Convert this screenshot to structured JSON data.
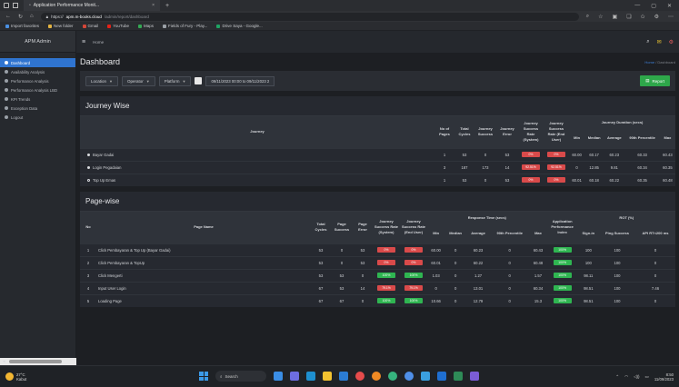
{
  "browser": {
    "tab_title": "Application Performance Monit...",
    "tab_close": "×",
    "new_tab": "+",
    "window_controls": [
      "—",
      "▢",
      "✕"
    ],
    "url_prefix": "https://",
    "url_host": "apm.m-books.cloud",
    "url_path": "/admin/report/dashboard",
    "nav": {
      "back": "←",
      "forward": "→",
      "reload": "↻",
      "home": "⌂"
    },
    "bookmarks": [
      {
        "label": "Import favorites",
        "color": "#4a90e2"
      },
      {
        "label": "New folder",
        "color": "#e3b341"
      },
      {
        "label": "Gmail",
        "color": "#d44638"
      },
      {
        "label": "YouTube",
        "color": "#e62117"
      },
      {
        "label": "Maps",
        "color": "#34a853"
      },
      {
        "label": "Fields of Fury - Play...",
        "color": "#9aa0a6"
      },
      {
        "label": "Drive Saya - Google...",
        "color": "#1fa463"
      }
    ]
  },
  "sidebar": {
    "brand": "APM Admin",
    "items": [
      {
        "label": "Dashboard",
        "active": true
      },
      {
        "label": "Availability Analysis",
        "active": false
      },
      {
        "label": "Performance Analysis",
        "active": false
      },
      {
        "label": "Performance Analysis LBD",
        "active": false
      },
      {
        "label": "KPI Trends",
        "active": false
      },
      {
        "label": "Exception Data",
        "active": false
      },
      {
        "label": "Logout",
        "active": false
      }
    ]
  },
  "topbar": {
    "menu_icon": "≡",
    "home_label": "Home"
  },
  "header": {
    "title": "Dashboard",
    "crumb_home": "Home",
    "crumb_sep": " / ",
    "crumb_current": "Dashboard"
  },
  "filters": {
    "location": "Location",
    "operator": "Operator",
    "platform": "Platform",
    "date_range": "09/11/2023 00:00 to 09/11/2023 2",
    "report_button": "Report"
  },
  "journey_wise": {
    "title": "Journey Wise",
    "headers": {
      "journey": "Journey",
      "no_pages": "No of Pages",
      "total_cycles": "Total Cycles",
      "journey_success": "Journey Success",
      "journey_error": "Journey Error",
      "success_rate_system": "Journey Success Rate (System)",
      "success_rate_enduser": "Journey Success Rate (End User)",
      "duration_group": "Journey Duration (secs)",
      "min": "Min",
      "median": "Median",
      "average": "Average",
      "p90": "90th Percentile",
      "max": "Max"
    },
    "rows": [
      {
        "journey": "Bayar Gadai",
        "marker": "filled",
        "pages": "1",
        "cycles": "53",
        "success": "0",
        "error": "53",
        "rate_sys": "0%",
        "rate_sys_color": "red",
        "rate_user": "0%",
        "rate_user_color": "red",
        "min": "60.00",
        "median": "60.17",
        "average": "60.23",
        "p90": "60.33",
        "max": "60.43"
      },
      {
        "journey": "Login Pegadaian",
        "marker": "filled",
        "pages": "3",
        "cycles": "187",
        "success": "173",
        "error": "14",
        "rate_sys": "92.51%",
        "rate_sys_color": "red",
        "rate_user": "92.51%",
        "rate_user_color": "red",
        "min": "0",
        "median": "12.85",
        "average": "9.81",
        "p90": "60.34",
        "max": "60.35"
      },
      {
        "journey": "Top Up Emas",
        "marker": "ring",
        "pages": "1",
        "cycles": "53",
        "success": "0",
        "error": "53",
        "rate_sys": "0%",
        "rate_sys_color": "red",
        "rate_user": "0%",
        "rate_user_color": "red",
        "min": "60.01",
        "median": "60.18",
        "average": "60.22",
        "p90": "60.35",
        "max": "60.48"
      }
    ]
  },
  "page_wise": {
    "title": "Page-wise",
    "headers": {
      "no": "No",
      "page_name": "Page Name",
      "total_cycles": "Total Cycles",
      "page_success": "Page Success",
      "page_error": "Page Error",
      "success_rate_system": "Journey Success Rate (System)",
      "success_rate_enduser": "Journey Success Rate (End User)",
      "response_group": "Response Time (secs)",
      "min": "Min",
      "median": "Median",
      "average": "Average",
      "p90": "90th Percentile",
      "max": "Max",
      "apdex": "Application Performance Index",
      "rot_group": "ROT (%)",
      "sign_in": "Sign-in",
      "ping_success": "Ping Success",
      "api": "API RT<200 ms"
    },
    "rows": [
      {
        "no": "1",
        "name": "Click Pembayaran & Top Up (Bayar Gadai)",
        "cycles": "53",
        "success": "0",
        "error": "53",
        "rate_sys": "0%",
        "rate_sys_color": "red",
        "rate_user": "0%",
        "rate_user_color": "red",
        "min": "60.00",
        "median": "0",
        "average": "60.23",
        "p90": "0",
        "max": "60.43",
        "apdex": "100%",
        "sign": "100",
        "ping": "100",
        "api": "0"
      },
      {
        "no": "2",
        "name": "Click Pembayaran & TopUp",
        "cycles": "53",
        "success": "0",
        "error": "53",
        "rate_sys": "0%",
        "rate_sys_color": "red",
        "rate_user": "0%",
        "rate_user_color": "red",
        "min": "60.01",
        "median": "0",
        "average": "60.22",
        "p90": "0",
        "max": "60.48",
        "apdex": "100%",
        "sign": "100",
        "ping": "100",
        "api": "0"
      },
      {
        "no": "3",
        "name": "Click Mengerti",
        "cycles": "53",
        "success": "53",
        "error": "0",
        "rate_sys": "100%",
        "rate_sys_color": "green",
        "rate_user": "100%",
        "rate_user_color": "green",
        "min": "1.03",
        "median": "0",
        "average": "1.27",
        "p90": "0",
        "max": "1.57",
        "apdex": "100%",
        "sign": "98.11",
        "ping": "100",
        "api": "0"
      },
      {
        "no": "4",
        "name": "Input User Login",
        "cycles": "67",
        "success": "53",
        "error": "14",
        "rate_sys": "79.1%",
        "rate_sys_color": "red",
        "rate_user": "79.1%",
        "rate_user_color": "red",
        "min": "0",
        "median": "0",
        "average": "13.01",
        "p90": "0",
        "max": "60.34",
        "apdex": "100%",
        "sign": "98.51",
        "ping": "100",
        "api": "7.46"
      },
      {
        "no": "5",
        "name": "Loading Page",
        "cycles": "67",
        "success": "67",
        "error": "0",
        "rate_sys": "100%",
        "rate_sys_color": "green",
        "rate_user": "100%",
        "rate_user_color": "green",
        "min": "10.66",
        "median": "0",
        "average": "12.79",
        "p90": "0",
        "max": "15.3",
        "apdex": "100%",
        "sign": "98.51",
        "ping": "100",
        "api": "0"
      }
    ]
  },
  "taskbar": {
    "temp": "27°C",
    "weather": "Kabut",
    "search": "Search",
    "time": "8:50",
    "date": "11/09/2023"
  },
  "colors": {
    "accent": "#2f74d0",
    "success": "#2fb551",
    "danger": "#d94a4a",
    "report": "#2ea74a"
  }
}
